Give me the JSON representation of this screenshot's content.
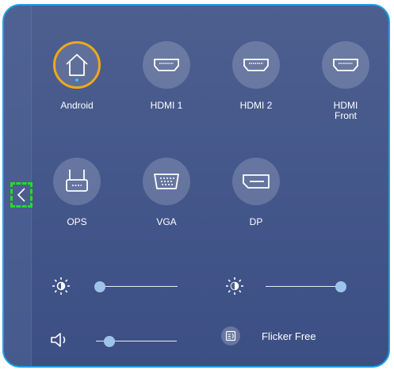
{
  "sources": [
    {
      "id": "android",
      "label": "Android",
      "icon": "home-icon",
      "active": true
    },
    {
      "id": "hdmi1",
      "label": "HDMI 1",
      "icon": "hdmi-icon",
      "active": false
    },
    {
      "id": "hdmi2",
      "label": "HDMI 2",
      "icon": "hdmi-icon",
      "active": false
    },
    {
      "id": "hdmi-front",
      "label": "HDMI\nFront",
      "icon": "hdmi-icon",
      "active": false
    },
    {
      "id": "ops",
      "label": "OPS",
      "icon": "ops-icon",
      "active": false
    },
    {
      "id": "vga",
      "label": "VGA",
      "icon": "vga-icon",
      "active": false
    },
    {
      "id": "dp",
      "label": "DP",
      "icon": "displayport-icon",
      "active": false
    }
  ],
  "controls": {
    "brightness": {
      "icon": "brightness-low-icon",
      "level": 0.0
    },
    "contrast": {
      "icon": "brightness-high-icon",
      "level": 1.0
    },
    "volume": {
      "icon": "speaker-icon",
      "level": 0.17
    },
    "flicker_free": {
      "icon": "flicker-free-icon",
      "label": "Flicker Free"
    }
  },
  "colors": {
    "accent_active": "#f0a818",
    "border": "#1aa3e6",
    "knob": "#9fc4ec",
    "focus_dash": "#22dd22"
  }
}
